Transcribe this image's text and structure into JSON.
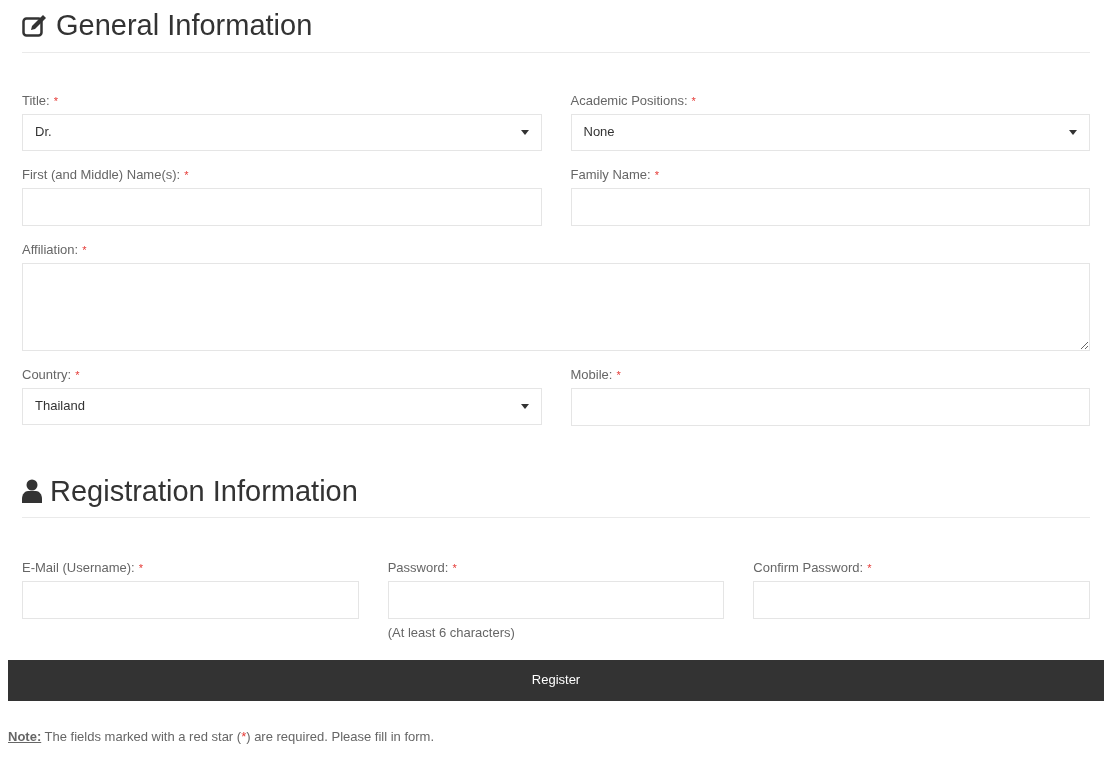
{
  "general": {
    "heading": "General Information",
    "rows": [
      [
        {
          "label": "Title:",
          "star": "*",
          "kind": "select",
          "value": "Dr."
        },
        {
          "label": "Academic Positions:",
          "star": "*",
          "kind": "select",
          "value": "None"
        }
      ],
      [
        {
          "label": "First (and Middle) Name(s):",
          "star": "*",
          "kind": "input"
        },
        {
          "label": "Family Name:",
          "star": "*",
          "kind": "input"
        }
      ],
      [
        {
          "label": "Affiliation:",
          "star": "*",
          "kind": "textarea"
        }
      ],
      [
        {
          "label": "Country:",
          "star": "*",
          "kind": "select",
          "value": "Thailand"
        },
        {
          "label": "Mobile:",
          "star": "*",
          "kind": "input"
        }
      ]
    ]
  },
  "registration": {
    "heading": "Registration Information",
    "fields": [
      {
        "label": "E-Mail (Username):",
        "star": "*",
        "kind": "input"
      },
      {
        "label": "Password:",
        "star": "*",
        "kind": "input",
        "hint": "(At least 6 characters)"
      },
      {
        "label": "Confirm Password:",
        "star": "*",
        "kind": "input"
      }
    ]
  },
  "register_button": "Register",
  "note": {
    "label": "Note:",
    "before": "The fields marked with a red star (",
    "star": "*",
    "after": ") are required. Please fill in form."
  }
}
